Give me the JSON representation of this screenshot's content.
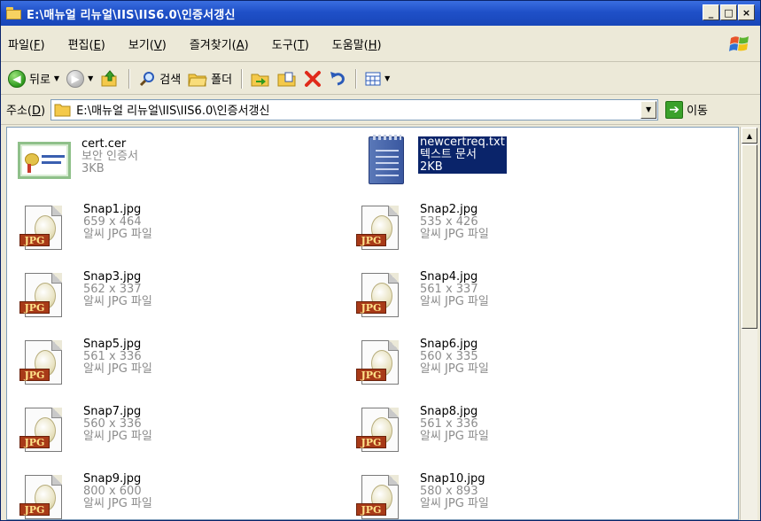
{
  "window": {
    "title": "E:\\매뉴얼 리뉴얼\\IIS\\IIS6.0\\인증서갱신",
    "minimize": "_",
    "maximize": "□",
    "close": "×"
  },
  "menu": [
    {
      "label": "파일(",
      "key": "F",
      "end": ")"
    },
    {
      "label": "편집(",
      "key": "E",
      "end": ")"
    },
    {
      "label": "보기(",
      "key": "V",
      "end": ")"
    },
    {
      "label": "즐겨찾기(",
      "key": "A",
      "end": ")"
    },
    {
      "label": "도구(",
      "key": "T",
      "end": ")"
    },
    {
      "label": "도움말(",
      "key": "H",
      "end": ")"
    }
  ],
  "toolbar": {
    "back_label": "뒤로",
    "search_label": "검색",
    "folders_label": "폴더"
  },
  "address": {
    "label": "주소(",
    "key": "D",
    "end": ")",
    "path": "E:\\매뉴얼 리뉴얼\\IIS\\IIS6.0\\인증서갱신",
    "go_label": "이동"
  },
  "files": [
    {
      "name": "cert.cer",
      "meta1": "보안 인증서",
      "meta2": "3KB",
      "type": "cert",
      "selected": false
    },
    {
      "name": "newcertreq.txt",
      "meta1": "텍스트 문서",
      "meta2": "2KB",
      "type": "txt",
      "selected": true
    },
    {
      "name": "Snap1.jpg",
      "meta1": "659 x 464",
      "meta2": "알씨 JPG 파일",
      "type": "jpg",
      "badge": "JPG"
    },
    {
      "name": "Snap2.jpg",
      "meta1": "535 x 426",
      "meta2": "알씨 JPG 파일",
      "type": "jpg",
      "badge": "JPG"
    },
    {
      "name": "Snap3.jpg",
      "meta1": "562 x 337",
      "meta2": "알씨 JPG 파일",
      "type": "jpg",
      "badge": "JPG"
    },
    {
      "name": "Snap4.jpg",
      "meta1": "561 x 337",
      "meta2": "알씨 JPG 파일",
      "type": "jpg",
      "badge": "JPG"
    },
    {
      "name": "Snap5.jpg",
      "meta1": "561 x 336",
      "meta2": "알씨 JPG 파일",
      "type": "jpg",
      "badge": "JPG"
    },
    {
      "name": "Snap6.jpg",
      "meta1": "560 x 335",
      "meta2": "알씨 JPG 파일",
      "type": "jpg",
      "badge": "JPG"
    },
    {
      "name": "Snap7.jpg",
      "meta1": "560 x 336",
      "meta2": "알씨 JPG 파일",
      "type": "jpg",
      "badge": "JPG"
    },
    {
      "name": "Snap8.jpg",
      "meta1": "561 x 336",
      "meta2": "알씨 JPG 파일",
      "type": "jpg",
      "badge": "JPG"
    },
    {
      "name": "Snap9.jpg",
      "meta1": "800 x 600",
      "meta2": "알씨 JPG 파일",
      "type": "jpg",
      "badge": "JPG"
    },
    {
      "name": "Snap10.jpg",
      "meta1": "580 x 893",
      "meta2": "알씨 JPG 파일",
      "type": "jpg",
      "badge": "JPG"
    }
  ],
  "colors": {
    "titlebar": "#1f50c8",
    "selection": "#0a246a",
    "jpg_badge": "#a83a18"
  }
}
